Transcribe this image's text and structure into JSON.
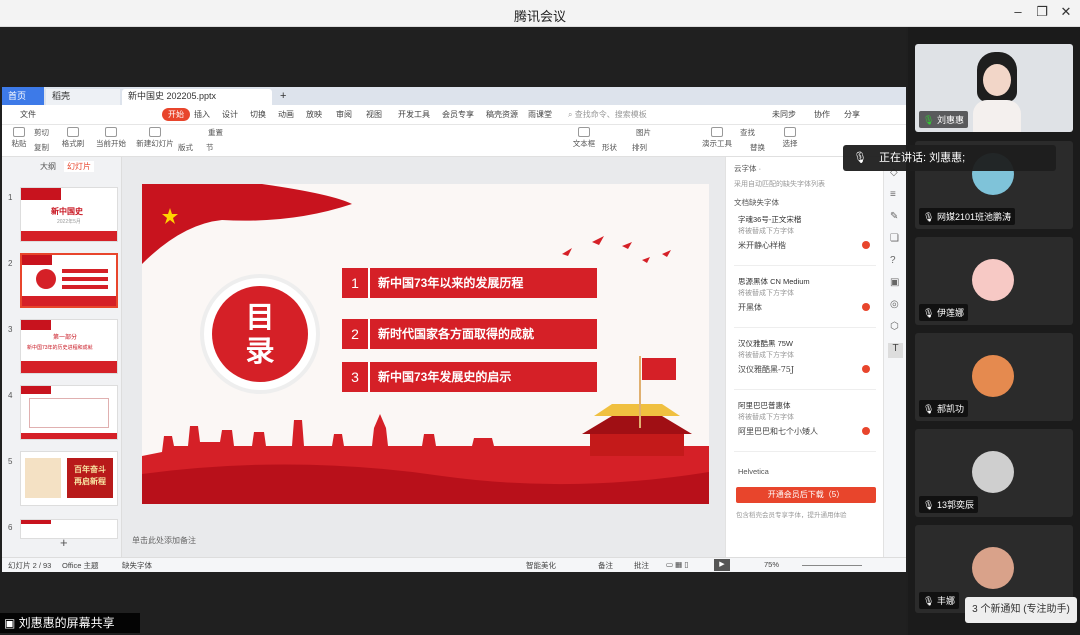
{
  "window": {
    "title": "腾讯会议"
  },
  "wps": {
    "tabs": {
      "home": "首页",
      "shell": "稻壳",
      "doc": "新中国史 202205.pptx"
    },
    "menu": [
      "文件",
      "开始",
      "插入",
      "设计",
      "切换",
      "动画",
      "放映",
      "审阅",
      "视图",
      "开发工具",
      "会员专享",
      "稿壳资源",
      "雨课堂"
    ],
    "search_placeholder": "查找命令、搜索模板",
    "top_right": {
      "sync": "未同步",
      "collab": "协作",
      "share": "分享"
    },
    "ribbon": {
      "paste": "粘贴",
      "cut": "剪切",
      "copy": "复制",
      "format": "格式刷",
      "from_current": "当前开始",
      "new_slide": "新建幻灯片",
      "layout": "版式",
      "section": "节",
      "reset": "重置",
      "textbox": "文本框",
      "shape": "形状",
      "arrange": "排列",
      "picture": "图片",
      "find": "查找",
      "replace": "替换",
      "select": "选择",
      "present_tool": "演示工具"
    },
    "left_tabs": {
      "outline": "大纲",
      "slides": "幻灯片"
    },
    "thumbs": [
      {
        "num": "1",
        "title": "新中国史",
        "sub": "2022年5月"
      },
      {
        "num": "2",
        "title": "目录",
        "sub": ""
      },
      {
        "num": "3",
        "title": "第一部分",
        "sub": "新中国73年的历史进程和成就"
      },
      {
        "num": "4",
        "title": "",
        "sub": ""
      },
      {
        "num": "5",
        "title": "百年奋斗",
        "sub": "再启新程"
      },
      {
        "num": "6",
        "title": "",
        "sub": ""
      }
    ],
    "slide": {
      "badge": "目录",
      "items": [
        {
          "num": "1",
          "text": "新中国73年以来的发展历程"
        },
        {
          "num": "2",
          "text": "新时代国家各方面取得的成就"
        },
        {
          "num": "3",
          "text": "新中国73年发展史的启示"
        }
      ]
    },
    "notes_placeholder": "单击此处添加备注",
    "font_panel": {
      "header": "云字体 ·",
      "note": "采用自动匹配的缺失字体列表",
      "section": "文档缺失字体",
      "fonts": [
        {
          "name": "字魂36号-正文宋楷",
          "sub": "将被替成下方字体",
          "sample": "米开静心样楷"
        },
        {
          "name": "思源黑体 CN Medium",
          "sub": "将被替成下方字体",
          "sample": "开黑体"
        },
        {
          "name": "汉仪雅酷黑 75W",
          "sub": "将被替成下方字体",
          "sample": "汉仪雅酷黑-75J"
        },
        {
          "name": "阿里巴巴普惠体",
          "sub": "将被替成下方字体",
          "sample": "阿里巴巴和七个小矮人"
        }
      ],
      "extra_font": "Helvetica",
      "download_button": "开通会员后下载（5）",
      "footnote": "包含稻壳会员专享字体，提升通用体验"
    },
    "status": {
      "slide_pos": "幻灯片 2 / 93",
      "theme": "Office 主题",
      "missing_font": "缺失字体",
      "beautify": "智能美化",
      "notes": "备注",
      "comments": "批注",
      "zoom": "75%"
    }
  },
  "meeting": {
    "speaking_label": "正在讲话: 刘惠惠;",
    "share_label": "刘惠惠的屏幕共享",
    "notification": "3 个新通知 (专注助手)",
    "participants": [
      "刘惠惠",
      "网媒2101班池鹏涛",
      "伊莲娜",
      "郝凯功",
      "13郭奕辰",
      "丰娜"
    ]
  },
  "colors": {
    "accent": "#e8452c",
    "wps_blue": "#3d7ae8"
  }
}
